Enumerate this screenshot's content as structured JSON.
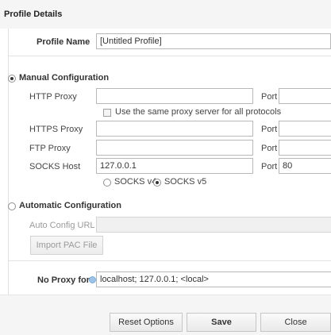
{
  "header": {
    "title": "Profile Details"
  },
  "profile": {
    "name_label": "Profile Name",
    "name_value": "[Untitled Profile]"
  },
  "manual": {
    "label": "Manual Configuration",
    "selected": true,
    "http_label": "HTTP Proxy",
    "http_value": "",
    "http_port_label": "Port",
    "http_port": "",
    "same_proxy_label": "Use the same proxy server for all protocols",
    "same_proxy_checked": false,
    "https_label": "HTTPS Proxy",
    "https_value": "",
    "https_port_label": "Port",
    "https_port": "",
    "ftp_label": "FTP Proxy",
    "ftp_value": "",
    "ftp_port_label": "Port",
    "ftp_port": "",
    "socks_label": "SOCKS Host",
    "socks_value": "127.0.0.1",
    "socks_port_label": "Port",
    "socks_port": "80",
    "socks_v4_label": "SOCKS v4",
    "socks_v5_label": "SOCKS v5",
    "socks_version_selected": "SOCKS v5"
  },
  "automatic": {
    "label": "Automatic Configuration",
    "selected": false,
    "url_label": "Auto Config URL",
    "url_value": "",
    "import_label": "Import PAC File"
  },
  "no_proxy": {
    "label": "No Proxy for",
    "value": "localhost; 127.0.0.1; <local>"
  },
  "footer": {
    "reset_label": "Reset Options",
    "save_label": "Save",
    "close_label": "Close"
  }
}
